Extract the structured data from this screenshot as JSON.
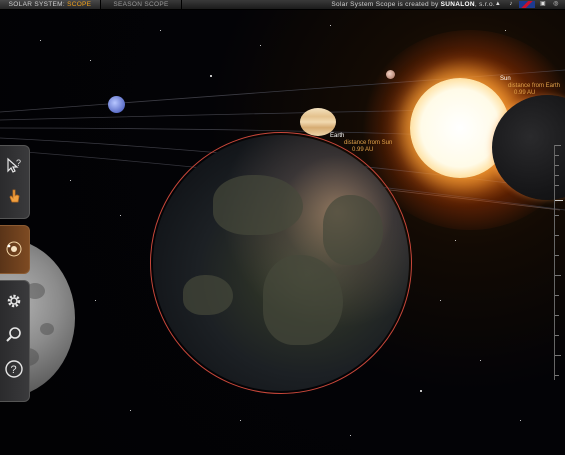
{
  "topbar": {
    "tab_solar_main": "SOLAR SYSTEM",
    "tab_solar_accent": "SCOPE",
    "tab_season": "SEASON SCOPE",
    "credit_text": "Solar System Scope is created by ",
    "credit_brand": "SUNALON",
    "credit_suffix": ", s.r.o."
  },
  "labels": {
    "earth_name": "Earth",
    "earth_distance_caption": "distance from Sun",
    "earth_distance_value": "0.99 AU",
    "sun_name": "Sun",
    "sun_distance_caption": "distance from Earth",
    "sun_distance_value": "0.99 AU"
  },
  "sidebar": {
    "select_icon": "cursor-help-icon",
    "hand_icon": "hand-icon",
    "orbit_icon": "orbit-view-icon",
    "settings_icon": "gear-icon",
    "search_icon": "search-icon",
    "help_icon": "help-icon"
  },
  "colors": {
    "accent": "#f3a21a",
    "selection_ring": "#c8473a",
    "label_sub": "#e0a24a"
  }
}
